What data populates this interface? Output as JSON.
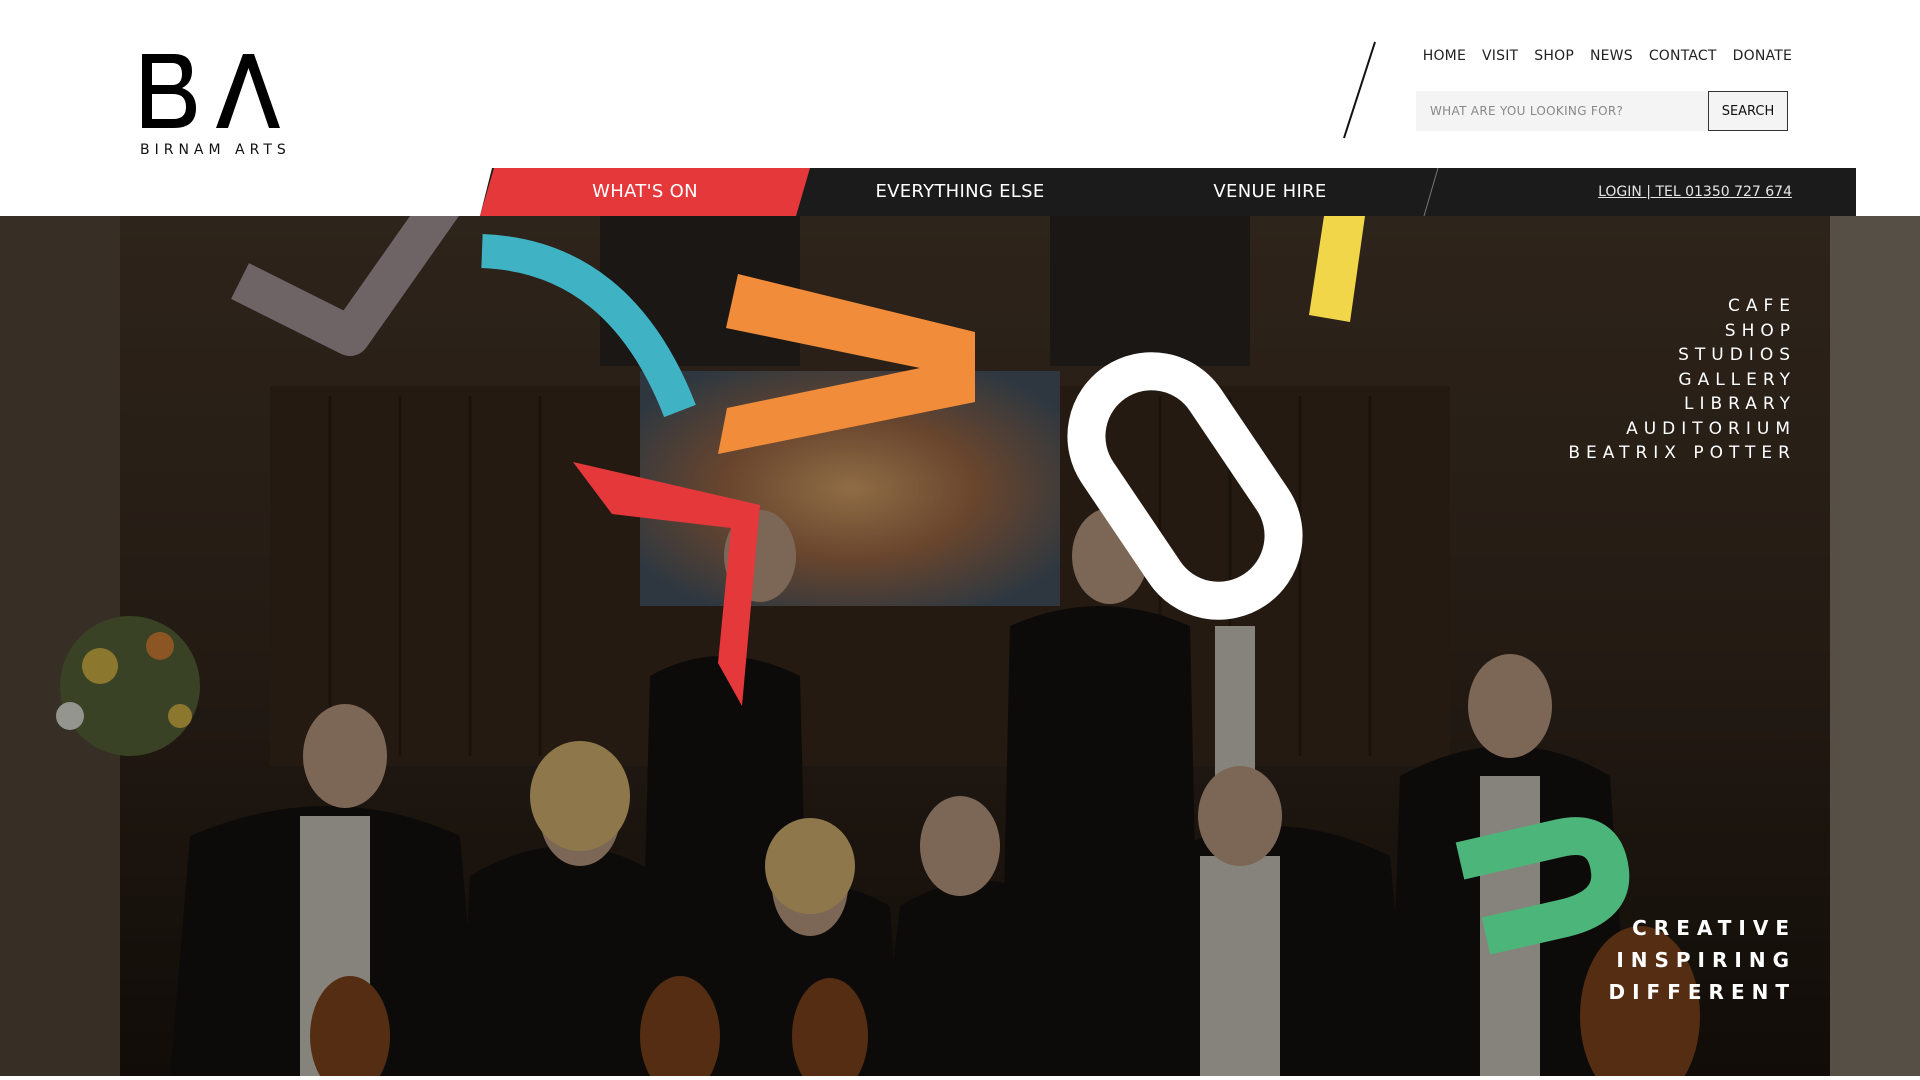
{
  "brand": {
    "logo_letters": "BΛ",
    "name": "BIRNAM ARTS"
  },
  "top_nav": [
    {
      "label": "HOME"
    },
    {
      "label": "VISIT"
    },
    {
      "label": "SHOP"
    },
    {
      "label": "NEWS"
    },
    {
      "label": "CONTACT"
    },
    {
      "label": "DONATE"
    }
  ],
  "search": {
    "placeholder": "WHAT ARE YOU LOOKING FOR?",
    "value": "",
    "button_label": "SEARCH",
    "icon": "search-icon"
  },
  "main_nav": {
    "items": [
      {
        "label": "WHAT'S ON",
        "active": true
      },
      {
        "label": "EVERYTHING ELSE",
        "active": false
      },
      {
        "label": "VENUE HIRE",
        "active": false
      }
    ],
    "login_tel": "LOGIN | TEL 01350 727 674"
  },
  "hero": {
    "side_links": [
      {
        "label": "CAFE"
      },
      {
        "label": "SHOP"
      },
      {
        "label": "STUDIOS"
      },
      {
        "label": "GALLERY"
      },
      {
        "label": "LIBRARY"
      },
      {
        "label": "AUDITORIUM"
      },
      {
        "label": "BEATRIX POTTER"
      }
    ],
    "tagline": [
      "CREATIVE",
      "INSPIRING",
      "DIFFERENT"
    ],
    "shape_colors": {
      "grey": "#6e6466",
      "teal": "#3fb3c4",
      "orange": "#f08c3a",
      "red": "#e5383b",
      "white": "#ffffff",
      "yellow": "#f2d649",
      "green": "#4cb57a"
    }
  },
  "colors": {
    "accent_red": "#e5383b",
    "nav_bar": "#1b1b1b"
  }
}
